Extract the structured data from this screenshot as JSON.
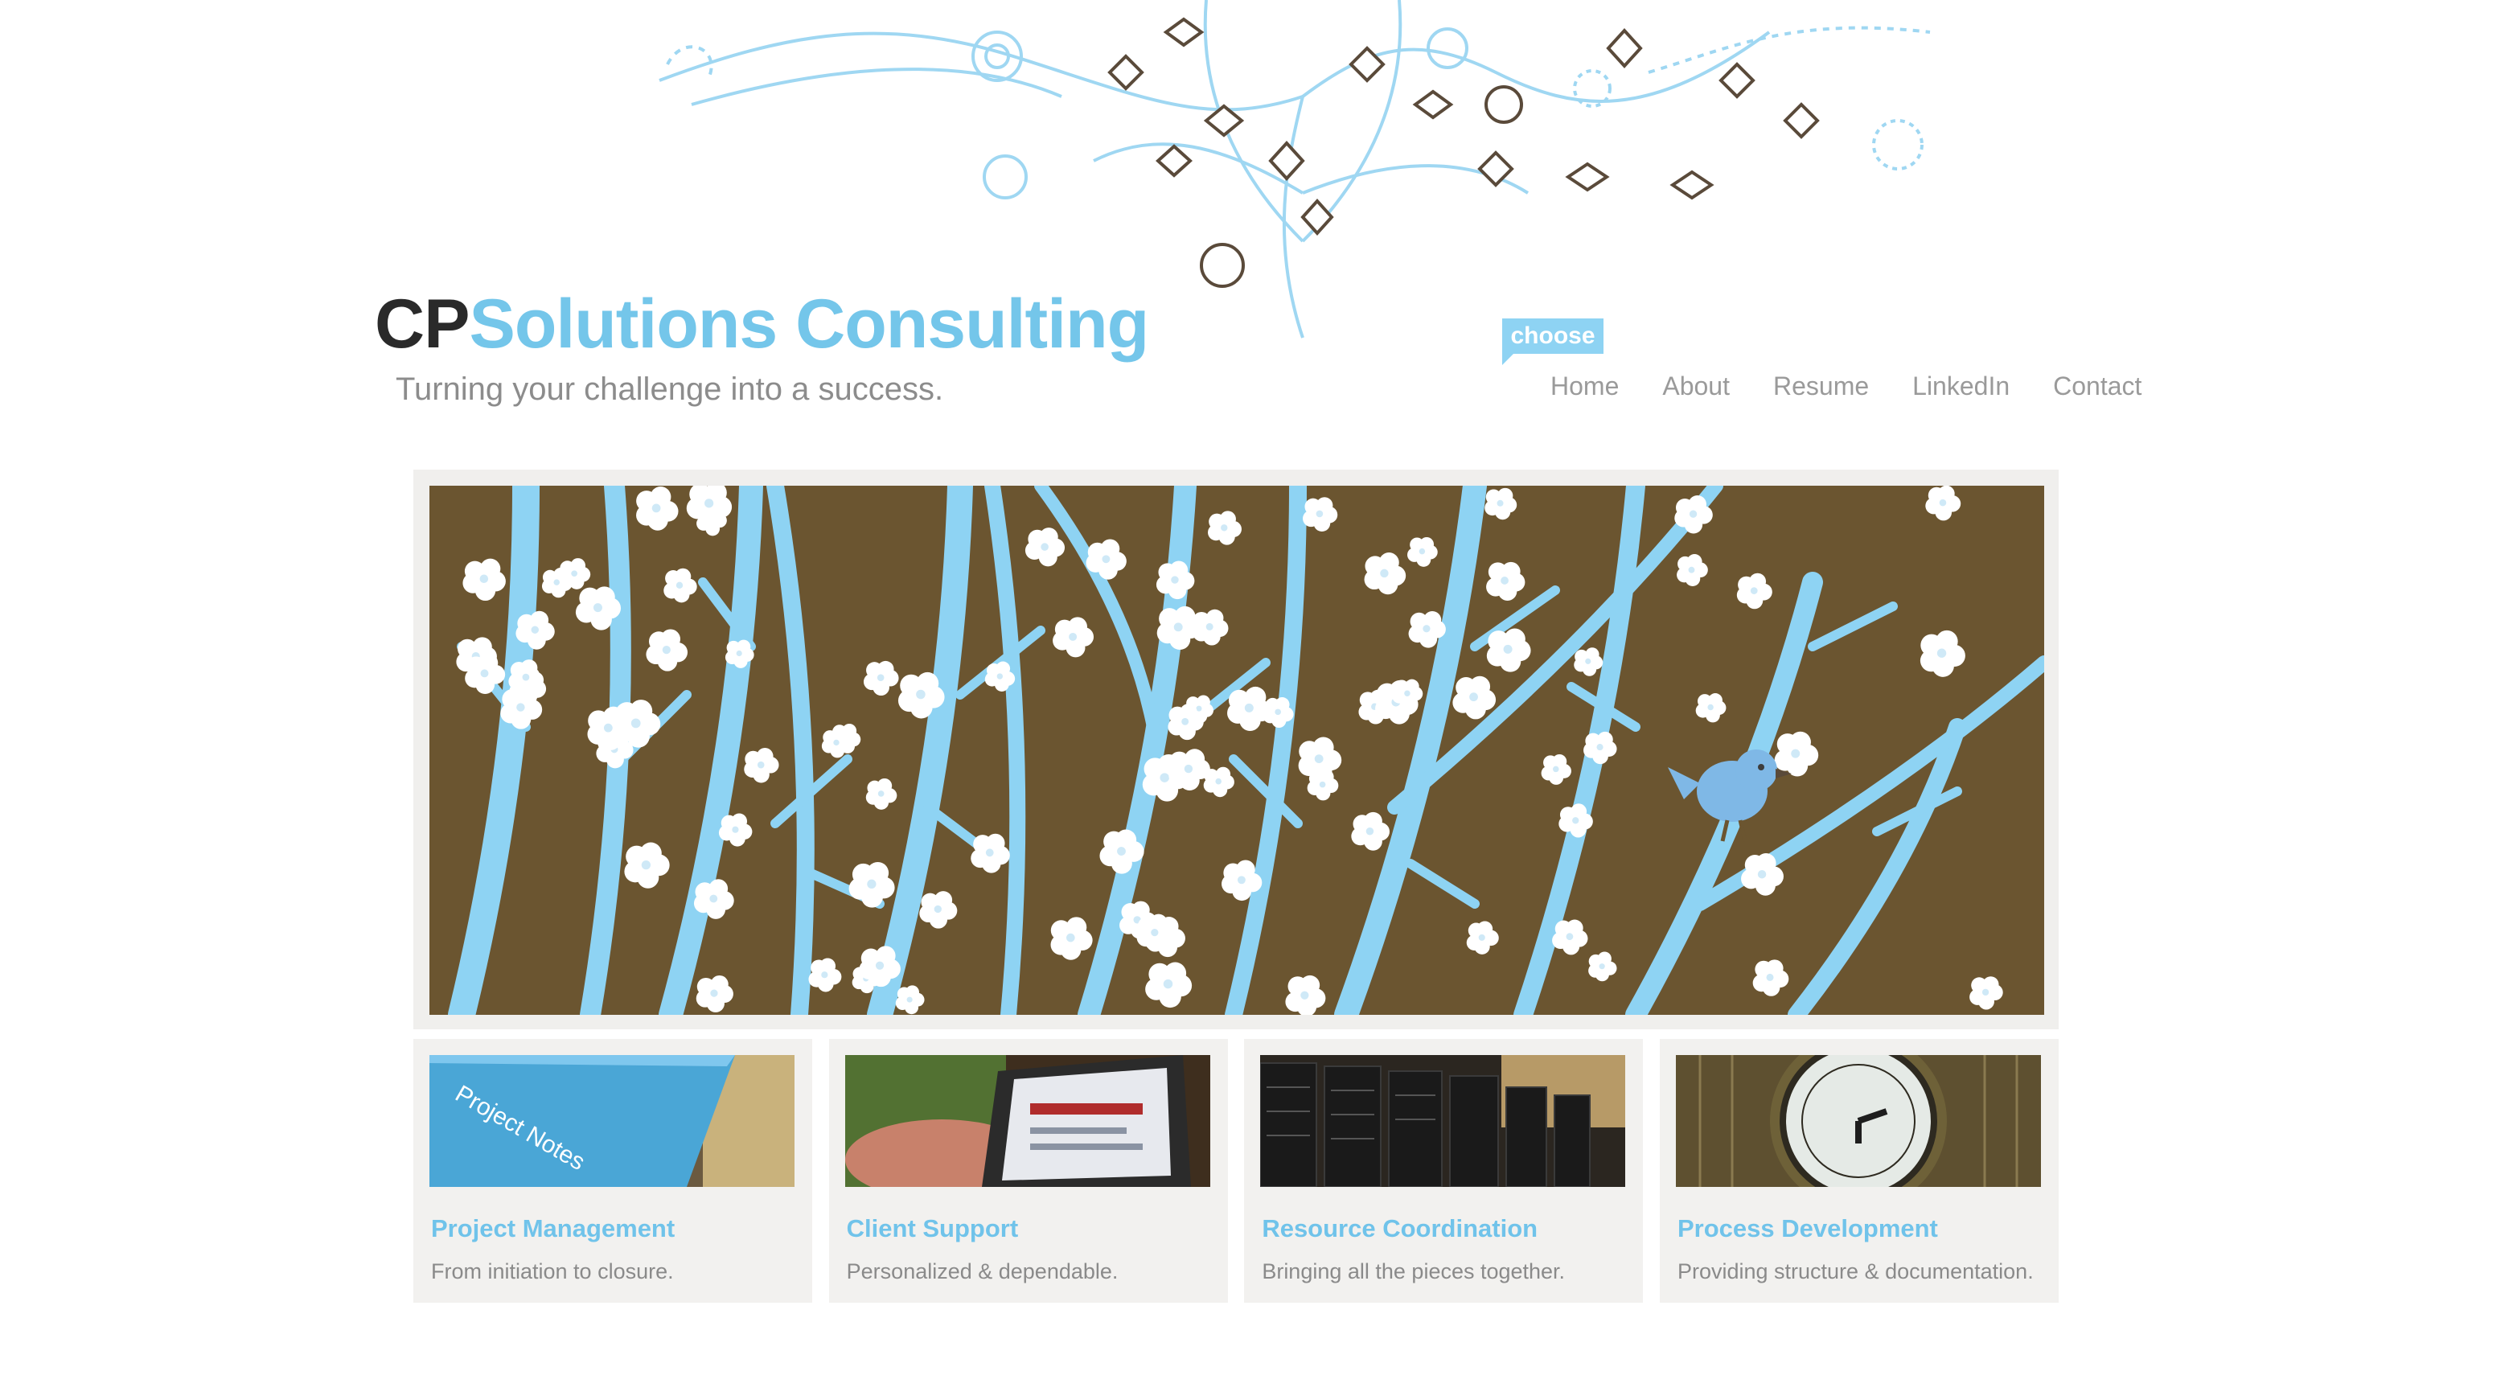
{
  "brand": {
    "logo_prefix": "CP",
    "logo_rest": "Solutions Consulting",
    "tagline": "Turning your challenge into a success.",
    "accent": "#74c6ea",
    "dark": "#2a2a2a"
  },
  "nav": {
    "badge": "choose",
    "items": [
      {
        "label": "Home"
      },
      {
        "label": "About"
      },
      {
        "label": "Resume"
      },
      {
        "label": "LinkedIn"
      },
      {
        "label": "Contact"
      }
    ]
  },
  "hero": {
    "background": "#6b5530",
    "branch_color": "#8ed3f3",
    "blossom_color": "#ffffff",
    "bird_color": "#7fb8e6"
  },
  "cards": [
    {
      "title": "Project Management",
      "desc": "From initiation to closure.",
      "image": "project-notes",
      "image_text": "Project Notes"
    },
    {
      "title": "Client Support",
      "desc": "Personalized & dependable.",
      "image": "handheld-device"
    },
    {
      "title": "Resource Coordination",
      "desc": "Bringing all the pieces together.",
      "image": "server-racks"
    },
    {
      "title": "Process Development",
      "desc": "Providing structure & documentation.",
      "image": "clock-tower"
    }
  ]
}
